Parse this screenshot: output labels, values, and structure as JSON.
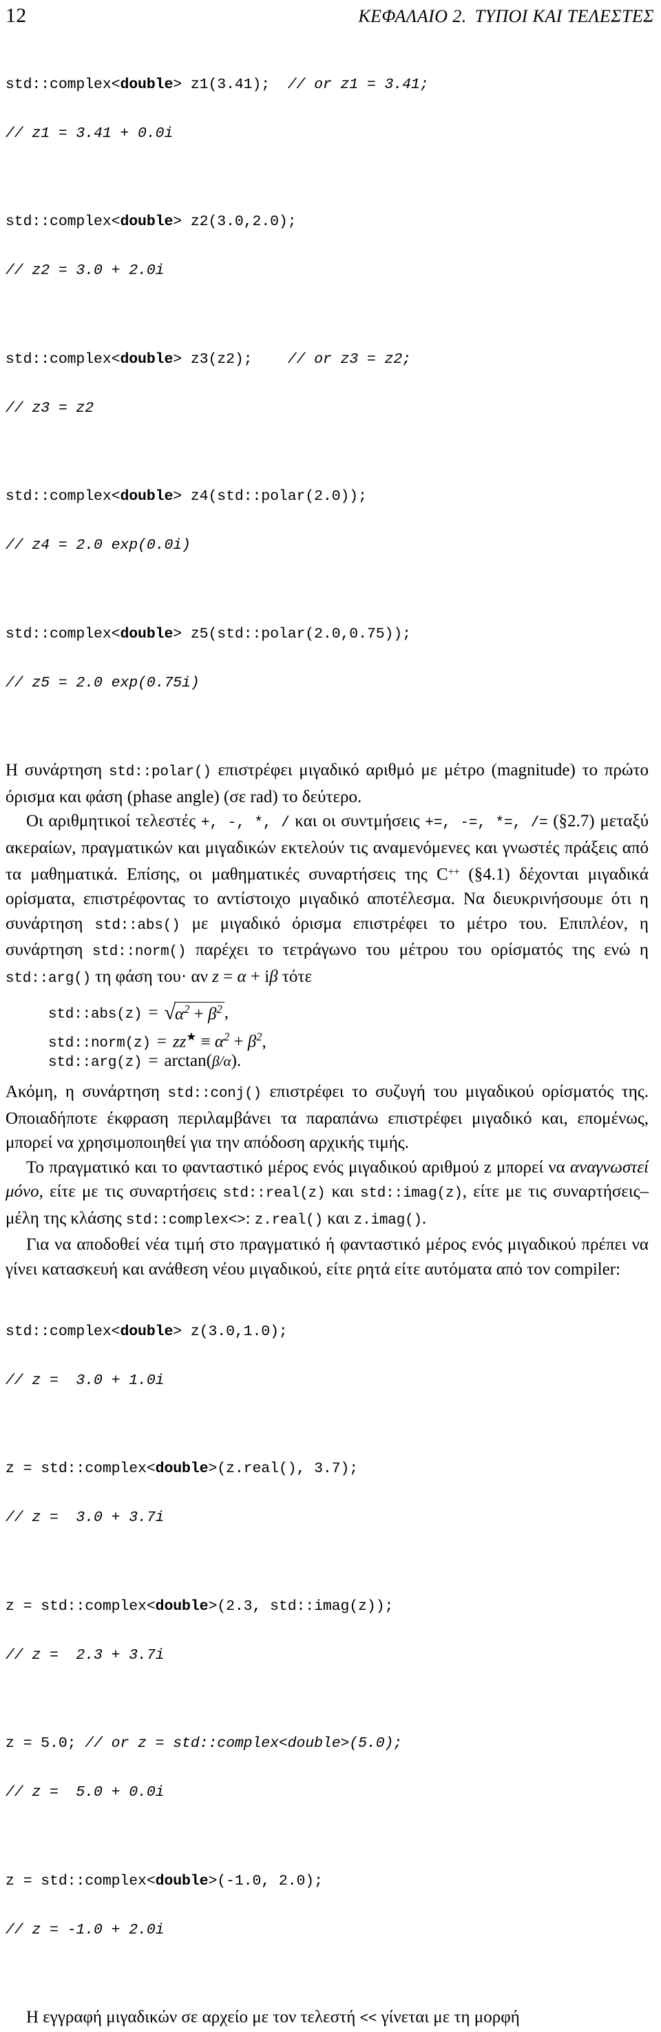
{
  "header": {
    "folio": "12",
    "chapter_title": "ΚΕΦΑΛΑΙΟ 2.",
    "chapter_subject": "ΤΥΠΟΙ ΚΑΙ ΤΕΛΕΣΤΕΣ"
  },
  "code_block_1": {
    "entries": [
      {
        "decl_pre": "std::complex<",
        "decl_bold": "double",
        "decl_post": "> z1(3.41);  ",
        "trailing_comment": "// or z1 = 3.41;",
        "comment_line": "// z1 = 3.41 + 0.0i"
      },
      {
        "decl_pre": "std::complex<",
        "decl_bold": "double",
        "decl_post": "> z2(3.0,2.0);",
        "trailing_comment": "",
        "comment_line": "// z2 = 3.0 + 2.0i"
      },
      {
        "decl_pre": "std::complex<",
        "decl_bold": "double",
        "decl_post": "> z3(z2);    ",
        "trailing_comment": "// or z3 = z2;",
        "comment_line": "// z3 = z2"
      },
      {
        "decl_pre": "std::complex<",
        "decl_bold": "double",
        "decl_post": "> z4(std::polar(2.0));",
        "trailing_comment": "",
        "comment_line": "// z4 = 2.0 exp(0.0i)"
      },
      {
        "decl_pre": "std::complex<",
        "decl_bold": "double",
        "decl_post": "> z5(std::polar(2.0,0.75));",
        "trailing_comment": "",
        "comment_line": "// z5 = 2.0 exp(0.75i)"
      }
    ]
  },
  "paragraphs": {
    "p1_a": "Η συνάρτηση ",
    "p1_code1": "std::polar()",
    "p1_b": " επιστρέφει μιγαδικό αριθμό με μέτρο (magnitude) το πρώτο όρισμα και φάση (phase angle) (σε rad) το δεύτερο.",
    "p2_a": "Οι αριθμητικοί τελεστές ",
    "p2_ops1": "+, -, *, /",
    "p2_b": " και οι συντμήσεις ",
    "p2_ops2": "+=, -=, *=, /=",
    "p2_c": " (§2.7) μεταξύ ακεραίων, πραγματικών και μιγαδικών εκτελούν τις αναμενόμενες και γνωστές πράξεις από τα μαθηματικά.  Επίσης, οι μαθηματικές συναρτήσεις της C",
    "p2_cpp_sup": "++",
    "p2_d": " (§4.1) δέχονται μιγαδικά ορίσματα, επιστρέφοντας το αντίστοιχο μιγαδικό αποτέλεσμα.  Να διευκρινήσουμε ότι η συνάρτηση ",
    "p2_code_abs": "std::abs()",
    "p2_e": " με μιγαδικό όρισμα επιστρέφει το μέτρο του.  Επιπλέον, η συνάρτηση ",
    "p2_code_norm": "std::norm()",
    "p2_f": " παρέχει το τετράγωνο του μέτρου του ορίσματός της ενώ η ",
    "p2_code_arg": "std::arg()",
    "p2_g": " τη φάση του· αν ",
    "p2_z": "z",
    "p2_h": " = ",
    "p2_alpha": "α",
    "p2_i": " + i",
    "p2_beta": "β",
    "p2_j": " τότε"
  },
  "math": {
    "abs_lhs": "std::abs(z)",
    "abs_eq": "=",
    "abs_radicand_alpha": "α",
    "abs_radicand_sup1": "2",
    "abs_radicand_plus": "+",
    "abs_radicand_beta": "β",
    "abs_radicand_sup2": "2",
    "abs_tail": ",",
    "norm_lhs": "std::norm(z)",
    "norm_eq": "=",
    "norm_zz": "zz",
    "norm_star": "★",
    "norm_equiv": "≡",
    "norm_alpha": "α",
    "norm_sup1": "2",
    "norm_plus": "+",
    "norm_beta": "β",
    "norm_sup2": "2",
    "norm_tail": ",",
    "arg_lhs": "std::arg(z)",
    "arg_eq": "=",
    "arg_fn": "arctan(",
    "arg_beta": "β",
    "arg_slash": "/",
    "arg_alpha": "α",
    "arg_close": ")."
  },
  "paragraphs2": {
    "p3_a": "Ακόμη, η συνάρτηση ",
    "p3_code": "std::conj()",
    "p3_b": " επιστρέφει το συζυγή του μιγαδικού ορίσματός της.  Οποιαδήποτε έκφραση περιλαμβάνει τα παραπάνω επιστρέφει μιγαδικό και, επομένως, μπορεί να χρησιμοποιηθεί για την απόδοση αρχικής τιμής.",
    "p4_a": "Το πραγματικό και το φανταστικό μέρος ενός μιγαδικού αριθμού z μπορεί να ",
    "p4_italic": "αναγνωστεί μόνο",
    "p4_b": ", είτε με τις συναρτήσεις ",
    "p4_code1": "std::real(z)",
    "p4_c": " και ",
    "p4_code2": "std::imag(z)",
    "p4_d": ", είτε με τις συναρτήσεις–μέλη της κλάσης ",
    "p4_code3": "std::complex<>",
    "p4_e": ": ",
    "p4_code4": "z.real()",
    "p4_f": " και ",
    "p4_code5": "z.imag()",
    "p4_g": ".",
    "p5": "Για να αποδοθεί νέα τιμή στο πραγματικό ή φανταστικό μέρος ενός μιγαδικού πρέπει να γίνει κατασκευή και ανάθεση νέου μιγαδικού, είτε ρητά είτε αυτόματα από τον compiler:"
  },
  "code_block_2": {
    "entries": [
      {
        "pre": "std::complex<",
        "bold": "double",
        "post": "> z(3.0,1.0);",
        "trailing_comment": "",
        "comment_line": "// z =  3.0 + 1.0i"
      },
      {
        "pre": "z = std::complex<",
        "bold": "double",
        "post": ">(z.real(), 3.7);",
        "trailing_comment": "",
        "comment_line": "// z =  3.0 + 3.7i"
      },
      {
        "pre": "z = std::complex<",
        "bold": "double",
        "post": ">(2.3, std::imag(z));",
        "trailing_comment": "",
        "comment_line": "// z =  2.3 + 3.7i"
      },
      {
        "pre": "z = 5.0; ",
        "bold": "",
        "post": "",
        "trailing_comment": "// or z = std::complex<double>(5.0);",
        "comment_line": "// z =  5.0 + 0.0i"
      },
      {
        "pre": "z = std::complex<",
        "bold": "double",
        "post": ">(-1.0, 2.0);",
        "trailing_comment": "",
        "comment_line": "// z = -1.0 + 2.0i"
      }
    ]
  },
  "footer": {
    "last_a": "Η εγγραφή μιγαδικών σε αρχείο με τον τελεστή ",
    "last_op": "<<",
    "last_b": " γίνεται με τη μορφή"
  }
}
